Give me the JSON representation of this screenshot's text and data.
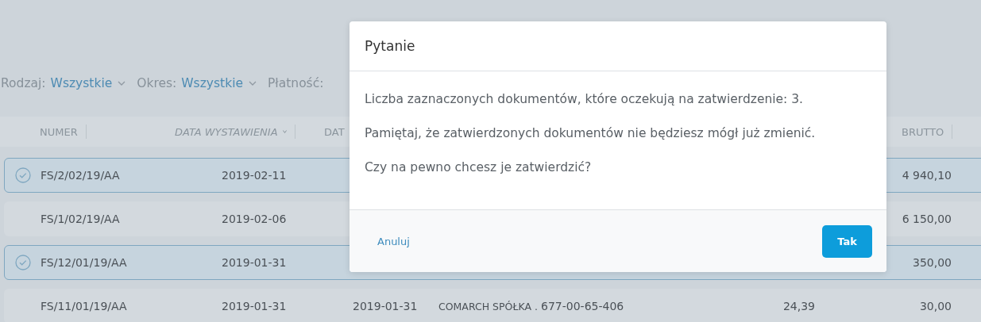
{
  "filters": [
    {
      "label": "Rodzaj:",
      "value": "Wszystkie"
    },
    {
      "label": "Okres:",
      "value": "Wszystkie"
    },
    {
      "label": "Płatność:"
    }
  ],
  "table": {
    "columns": [
      {
        "label": "NUMER",
        "sorted": false
      },
      {
        "label": "DATA WYSTAWIENIA",
        "sorted": true
      },
      {
        "label": "DAT",
        "sorted": false
      },
      {
        "label": "BRUTTO",
        "sorted": false
      }
    ],
    "rows": [
      {
        "selected": true,
        "numer": "FS/2/02/19/AA",
        "data_wystawienia": "2019-02-11",
        "brutto": "4 940,10"
      },
      {
        "selected": false,
        "numer": "FS/1/02/19/AA",
        "data_wystawienia": "2019-02-06",
        "brutto": "6 150,00"
      },
      {
        "selected": true,
        "numer": "FS/12/01/19/AA",
        "data_wystawienia": "2019-01-31",
        "brutto": "350,00"
      },
      {
        "selected": false,
        "numer": "FS/11/01/19/AA",
        "data_wystawienia": "2019-01-31",
        "column_3": "2019-01-31",
        "column_4": "COMARCH SPÓŁKA .",
        "column_5": "677-00-65-406",
        "column_6": "24,39",
        "brutto": "30,00"
      }
    ]
  },
  "dialog": {
    "title": "Pytanie",
    "paragraphs": [
      "Liczba zaznaczonych dokumentów, które oczekują na zatwierdzenie: 3.",
      "Pamiętaj, że zatwierdzonych dokumentów nie będziesz mógł już zmienić.",
      "Czy na pewno chcesz je zatwierdzić?"
    ],
    "cancel": "Anuluj",
    "confirm": "Tak"
  }
}
